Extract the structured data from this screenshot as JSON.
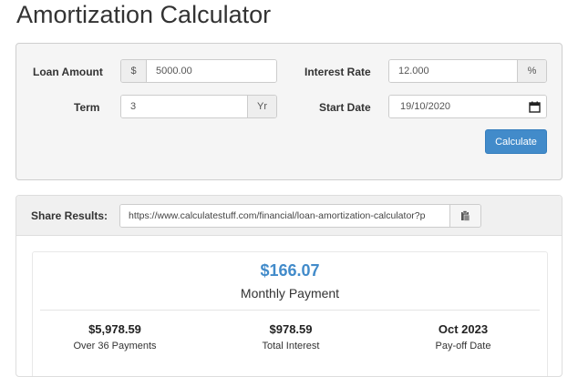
{
  "page": {
    "title": "Amortization Calculator"
  },
  "form": {
    "loan_amount": {
      "label": "Loan Amount",
      "prefix": "$",
      "value": "5000.00"
    },
    "interest_rate": {
      "label": "Interest Rate",
      "suffix": "%",
      "value": "12.000"
    },
    "term": {
      "label": "Term",
      "suffix": "Yr",
      "value": "3"
    },
    "start_date": {
      "label": "Start Date",
      "value": "19/10/2020"
    },
    "calculate_label": "Calculate"
  },
  "share": {
    "label": "Share Results:",
    "url": "https://www.calculatestuff.com/financial/loan-amortization-calculator?p"
  },
  "summary": {
    "monthly_payment": "$166.07",
    "monthly_label": "Monthly Payment",
    "stats": [
      {
        "value": "$5,978.59",
        "label": "Over 36 Payments"
      },
      {
        "value": "$978.59",
        "label": "Total Interest"
      },
      {
        "value": "Oct 2023",
        "label": "Pay-off Date"
      }
    ]
  },
  "colors": {
    "accent": "#428bca",
    "panel_bg": "#f5f5f5"
  },
  "icons": {
    "date": "calendar-icon",
    "copy": "clipboard-icon"
  }
}
